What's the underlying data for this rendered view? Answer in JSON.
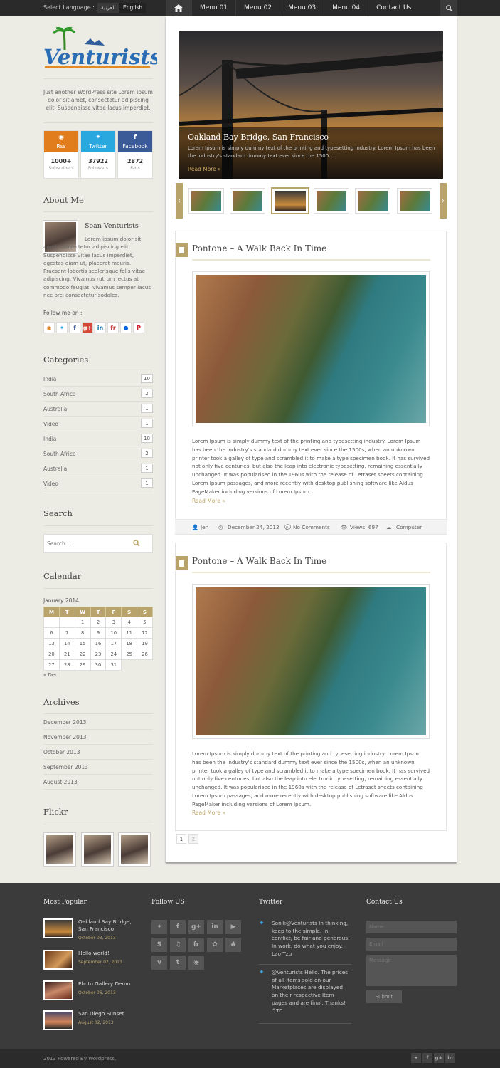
{
  "topbar": {
    "select_language": "Select Language :",
    "lang_arabic": "العربية",
    "lang_english": "English",
    "menu": [
      "Menu 01",
      "Menu 02",
      "Menu 03",
      "Menu 04",
      "Contact Us"
    ]
  },
  "logo": {
    "text": "Venturists"
  },
  "site_description": "Just another WordPress site Lorem ipsum dolor sit amet, consectetur adipiscing elit. Suspendisse vitae lacus imperdiet,",
  "social_counters": [
    {
      "label": "Rss",
      "count": "1000+",
      "unit": "Subscribers",
      "color": "#e17d1d",
      "icon": "rss-icon"
    },
    {
      "label": "Twitter",
      "count": "37922",
      "unit": "Followers",
      "color": "#29a7df",
      "icon": "twitter-icon"
    },
    {
      "label": "Facebook",
      "count": "2872",
      "unit": "Fans",
      "color": "#3b5a98",
      "icon": "facebook-icon"
    }
  ],
  "about": {
    "title": "About Me",
    "name": "Sean Venturists",
    "text": "Lorem ipsum dolor sit amet, consectetur adipiscing elit. Suspendisse vitae lacus imperdiet, egestas diam ut, placerat mauris. Praesent lobortis scelerisque felis vitae adipiscing. Vivamus rutrum lectus at commodo feugiat. Vivamus semper lacus nec orci consectetur sodales.",
    "follow_label": "Follow me on :",
    "follow_icons": [
      "rss-icon",
      "twitter-icon",
      "facebook-icon",
      "google-plus-icon",
      "linkedin-icon",
      "friendfeed-icon",
      "flickr-icon",
      "pinterest-icon"
    ]
  },
  "categories": {
    "title": "Categories",
    "items": [
      {
        "name": "India",
        "count": "10"
      },
      {
        "name": "South Africa",
        "count": "2"
      },
      {
        "name": "Australia",
        "count": "1"
      },
      {
        "name": "Video",
        "count": "1"
      },
      {
        "name": "India",
        "count": "10"
      },
      {
        "name": "South Africa",
        "count": "2"
      },
      {
        "name": "Australia",
        "count": "1"
      },
      {
        "name": "Video",
        "count": "1"
      }
    ]
  },
  "search": {
    "title": "Search",
    "placeholder": "Search ..."
  },
  "calendar": {
    "title": "Calendar",
    "caption": "January 2014",
    "days": [
      "M",
      "T",
      "W",
      "T",
      "F",
      "S",
      "S"
    ],
    "weeks": [
      [
        "",
        "",
        "1",
        "2",
        "3",
        "4",
        "5"
      ],
      [
        "6",
        "7",
        "8",
        "9",
        "10",
        "11",
        "12"
      ],
      [
        "13",
        "14",
        "15",
        "16",
        "17",
        "18",
        "19"
      ],
      [
        "20",
        "21",
        "22",
        "23",
        "24",
        "25",
        "26"
      ],
      [
        "27",
        "28",
        "29",
        "30",
        "31",
        "",
        ""
      ]
    ],
    "prev": "« Dec"
  },
  "archives": {
    "title": "Archives",
    "items": [
      "December 2013",
      "November 2013",
      "October 2013",
      "September 2013",
      "August 2013"
    ]
  },
  "flickr": {
    "title": "Flickr"
  },
  "slider": {
    "title": "Oakland Bay Bridge, San Francisco",
    "text": "Lorem Ipsum is simply dummy text of the printing and typesetting industry. Lorem Ipsum has been the industry's standard dummy text ever since the 1500...",
    "more": "Read More »"
  },
  "posts": [
    {
      "title": "Pontone – A Walk Back In Time",
      "text": "Lorem Ipsum is simply dummy text of the printing and typesetting industry. Lorem Ipsum has been the industry's standard dummy text ever since the 1500s, when an unknown printer took a galley of type and scrambled it to make a type specimen book. It has survived not only five centuries, but also the leap into electronic typesetting, remaining essentially unchanged. It was popularised in the 1960s with the release of Letraset sheets containing Lorem Ipsum passages, and more recently with desktop publishing software like Aldus PageMaker including versions of Lorem Ipsum.",
      "more": "Read More »",
      "meta": {
        "author": "Jen",
        "date": "December 24, 2013",
        "comments": "No Comments",
        "views": "Views: 697",
        "category": "Computer"
      }
    },
    {
      "title": "Pontone – A Walk Back In Time",
      "text": "Lorem Ipsum is simply dummy text of the printing and typesetting industry. Lorem Ipsum has been the industry's standard dummy text ever since the 1500s, when an unknown printer took a galley of type and scrambled it to make a type specimen book. It has survived not only five centuries, but also the leap into electronic typesetting, remaining essentially unchanged. It was popularised in the 1960s with the release of Letraset sheets containing Lorem Ipsum passages, and more recently with desktop publishing software like Aldus PageMaker including versions of Lorem Ipsum.",
      "more": "Read More »"
    }
  ],
  "pagination": [
    "1",
    "2"
  ],
  "footer": {
    "popular_title": "Most Popular",
    "popular": [
      {
        "title": "Oakland Bay Bridge, San Francisco",
        "date": "October 03, 2013"
      },
      {
        "title": "Hello world!",
        "date": "September 02, 2013"
      },
      {
        "title": "Photo Gallery Demo",
        "date": "October 06, 2013"
      },
      {
        "title": "San Diego Sunset",
        "date": "August 02, 2013"
      }
    ],
    "follow_title": "Follow US",
    "follow_icons": [
      "twitter-icon",
      "facebook-icon",
      "google-plus-icon",
      "linkedin-icon",
      "youtube-icon",
      "skype-icon",
      "lastfm-icon",
      "friendfeed-icon",
      "picasa-icon",
      "myspace-icon",
      "vimeo-icon",
      "tumblr-icon",
      "rss-icon"
    ],
    "twitter_title": "Twitter",
    "tweets": [
      "Sonik@Venturists In thinking, keep to the simple. In conflict, be fair and generous. In work, do what you enjoy. - Lao Tzu",
      "@Venturists Hello. The prices of all items sold on our Marketplaces are displayed on their respective Item pages and are final. Thanks! ^TC"
    ],
    "contact_title": "Contact Us",
    "name_placeholder": "Name",
    "email_placeholder": "Email",
    "message_placeholder": "Message",
    "submit": "Submit"
  },
  "copyright": "2013 Powered By Wordpress,",
  "bottom_icons": [
    "twitter-icon",
    "facebook-icon",
    "google-plus-icon",
    "linkedin-icon"
  ],
  "colors": {
    "accent": "#b8a46b",
    "topbar": "#2a2a2a",
    "footer": "#3b3b3b"
  }
}
